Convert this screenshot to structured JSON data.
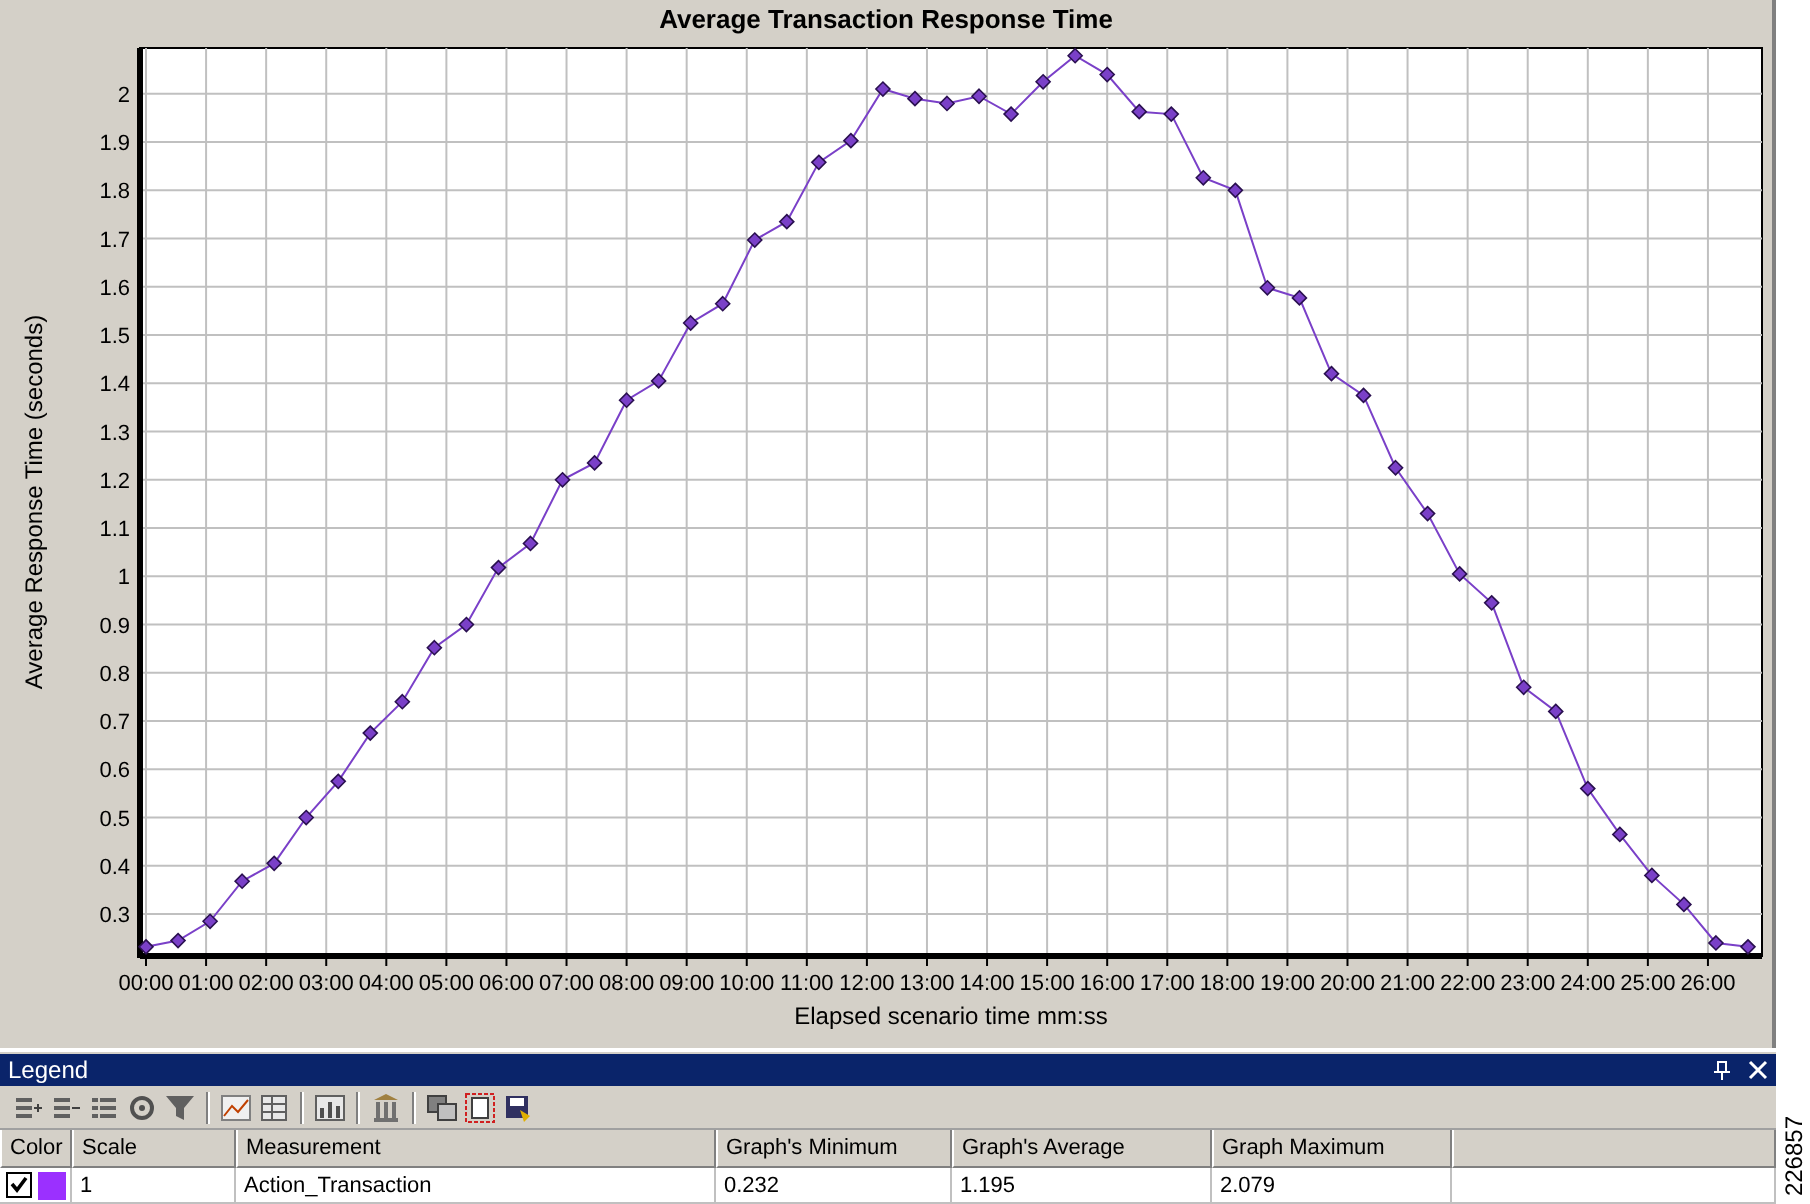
{
  "chart": {
    "chart_data": {
      "type": "line",
      "title": "Average Transaction Response Time",
      "xlabel": "Elapsed scenario time mm:ss",
      "ylabel": "Average Response Time (seconds)",
      "x": [
        0,
        32,
        64,
        96,
        128,
        160,
        192,
        224,
        256,
        288,
        320,
        352,
        384,
        416,
        448,
        480,
        512,
        544,
        576,
        608,
        640,
        672,
        704,
        736,
        768,
        800,
        832,
        864,
        896,
        928,
        960,
        992,
        1024,
        1056,
        1088,
        1120,
        1152,
        1184,
        1216,
        1248,
        1280,
        1312,
        1344,
        1376,
        1408,
        1440,
        1472,
        1504,
        1536,
        1568,
        1600
      ],
      "grid": true,
      "series": [
        {
          "color": "#7a40c8",
          "marker": "diamond",
          "values": [
            0.232,
            0.245,
            0.285,
            0.368,
            0.405,
            0.5,
            0.575,
            0.675,
            0.74,
            0.852,
            0.9,
            1.018,
            1.068,
            1.2,
            1.235,
            1.365,
            1.405,
            1.525,
            1.565,
            1.697,
            1.735,
            1.858,
            1.903,
            2.01,
            1.99,
            1.98,
            1.995,
            1.958,
            2.025,
            2.079,
            2.04,
            1.963,
            1.958,
            1.826,
            1.8,
            1.598,
            1.577,
            1.42,
            1.375,
            1.225,
            1.13,
            1.005,
            0.945,
            0.77,
            0.72,
            0.56,
            0.465,
            0.38,
            0.32,
            0.24,
            0.232
          ]
        }
      ],
      "xlim": [
        -6,
        1614
      ],
      "ylim": [
        0.213,
        2.095
      ],
      "xticks": [
        {
          "value": 0,
          "label": "00:00"
        },
        {
          "value": 60,
          "label": "01:00"
        },
        {
          "value": 120,
          "label": "02:00"
        },
        {
          "value": 180,
          "label": "03:00"
        },
        {
          "value": 240,
          "label": "04:00"
        },
        {
          "value": 300,
          "label": "05:00"
        },
        {
          "value": 360,
          "label": "06:00"
        },
        {
          "value": 420,
          "label": "07:00"
        },
        {
          "value": 480,
          "label": "08:00"
        },
        {
          "value": 540,
          "label": "09:00"
        },
        {
          "value": 600,
          "label": "10:00"
        },
        {
          "value": 660,
          "label": "11:00"
        },
        {
          "value": 720,
          "label": "12:00"
        },
        {
          "value": 780,
          "label": "13:00"
        },
        {
          "value": 840,
          "label": "14:00"
        },
        {
          "value": 900,
          "label": "15:00"
        },
        {
          "value": 960,
          "label": "16:00"
        },
        {
          "value": 1020,
          "label": "17:00"
        },
        {
          "value": 1080,
          "label": "18:00"
        },
        {
          "value": 1140,
          "label": "19:00"
        },
        {
          "value": 1200,
          "label": "20:00"
        },
        {
          "value": 1260,
          "label": "21:00"
        },
        {
          "value": 1320,
          "label": "22:00"
        },
        {
          "value": 1380,
          "label": "23:00"
        },
        {
          "value": 1440,
          "label": "24:00"
        },
        {
          "value": 1500,
          "label": "25:00"
        },
        {
          "value": 1560,
          "label": "26:00"
        }
      ],
      "yticks": [
        0.3,
        0.4,
        0.5,
        0.6,
        0.7,
        0.8,
        0.9,
        1,
        1.1,
        1.2,
        1.3,
        1.4,
        1.5,
        1.6,
        1.7,
        1.8,
        1.9,
        2
      ]
    }
  },
  "legend": {
    "title": "Legend",
    "columns": [
      "Color",
      "Scale",
      "Measurement",
      "Graph's Minimum",
      "Graph's Average",
      "Graph Maximum"
    ],
    "rows": [
      {
        "checked": true,
        "color": "#9b30ff",
        "cells": [
          "",
          "1",
          "Action_Transaction",
          "0.232",
          "1.195",
          "2.079"
        ]
      }
    ]
  },
  "side_label": "226857"
}
